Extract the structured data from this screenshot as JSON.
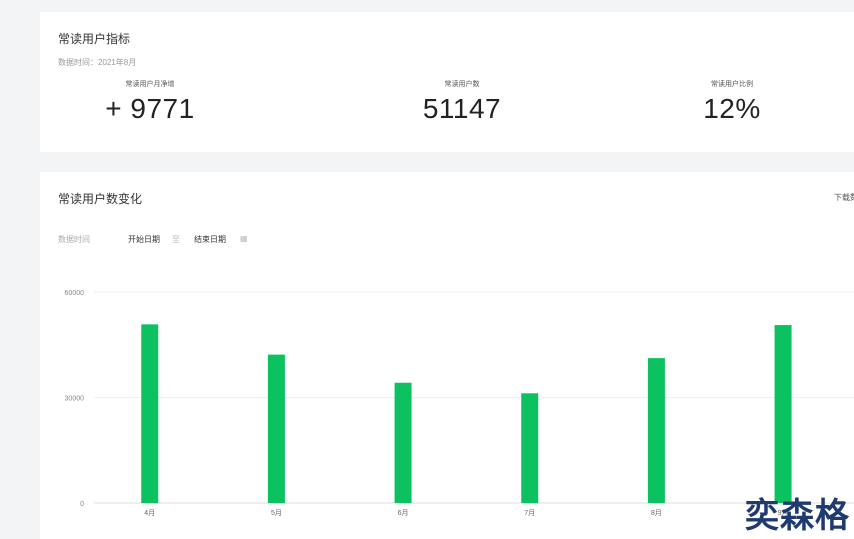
{
  "metrics_card": {
    "title": "常读用户指标",
    "data_time": "数据时间：2021年8月",
    "metrics": [
      {
        "label": "常读用户月净增",
        "value": "+ 9771"
      },
      {
        "label": "常读用户数",
        "value": "51147"
      },
      {
        "label": "常读用户比例",
        "value": "12%"
      }
    ]
  },
  "chart_card": {
    "title": "常读用户数变化",
    "download_label": "下载数据",
    "filter": {
      "label": "数据时间",
      "start_date": "开始日期",
      "separator": "至",
      "end_date": "结束日期"
    }
  },
  "watermark": "奕森格",
  "colors": {
    "bar": "#0cc160",
    "grid": "#eeeeee",
    "axis": "#dddddd"
  },
  "chart_data": {
    "type": "bar",
    "categories": [
      "4月",
      "5月",
      "6月",
      "7月",
      "8月",
      "9月"
    ],
    "values": [
      50800,
      42200,
      34200,
      31200,
      41200,
      50600
    ],
    "ylim": [
      0,
      60000
    ],
    "yticks": [
      "0",
      "30000",
      "60000"
    ],
    "ytick_values": [
      0,
      30000,
      60000
    ],
    "grid": true,
    "legend": "none"
  }
}
